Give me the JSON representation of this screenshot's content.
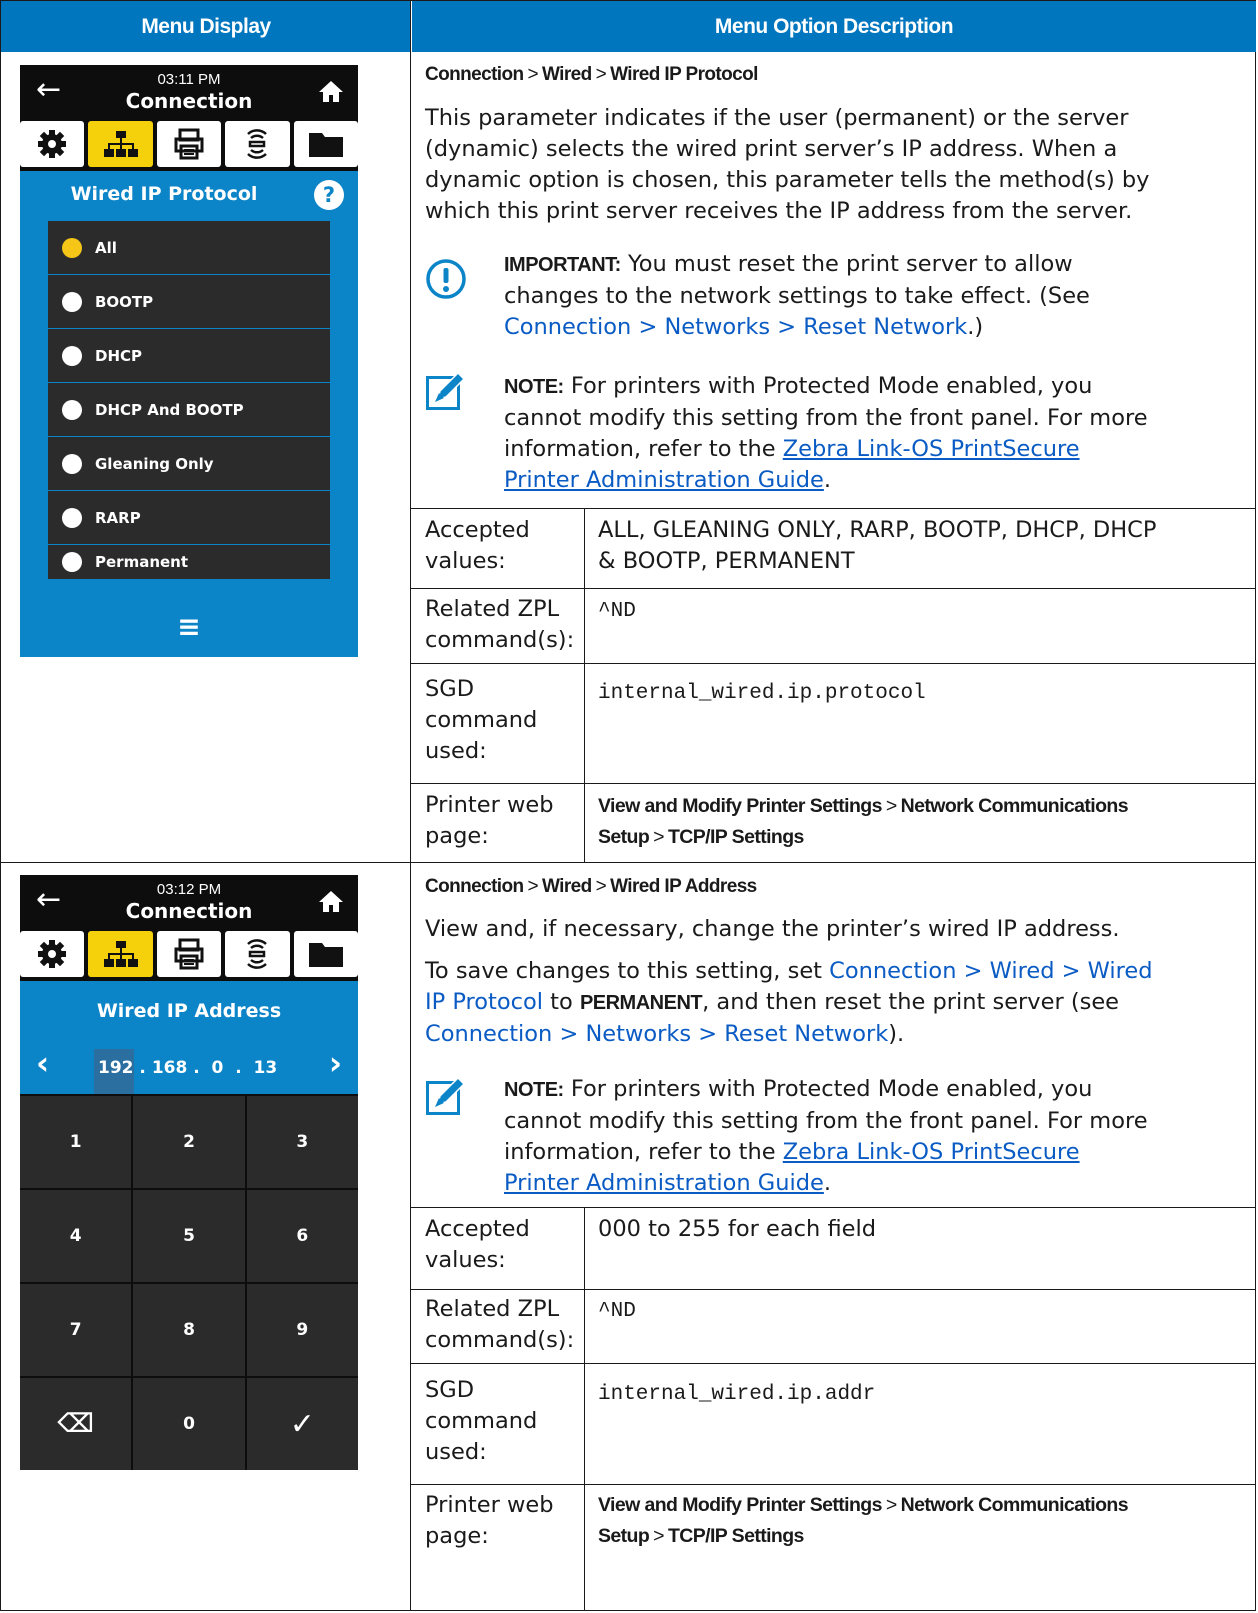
{
  "header": {
    "menu_display": "Menu Display",
    "menu_option_description": "Menu Option Description"
  },
  "row1": {
    "screen": {
      "time": "03:11 PM",
      "title": "Connection",
      "sub_title": "Wired IP Protocol",
      "help": "?",
      "options": [
        "All",
        "BOOTP",
        "DHCP",
        "DHCP And BOOTP",
        "Gleaning Only",
        "RARP",
        "Permanent"
      ],
      "selected_option": "All",
      "bottom_icon": "≡"
    },
    "path": {
      "p1": "Connection",
      "sep": ">",
      "p2": "Wired",
      "p3": "Wired IP Protocol"
    },
    "desc": [
      "This parameter indicates if the user (permanent) or the server",
      "(dynamic) selects the wired print server’s IP address. When a",
      "dynamic option is chosen, this parameter tells the method(s) by",
      "which this print server receives the IP address from the server."
    ],
    "important": {
      "label": "IMPORTANT:",
      "l1": " You must reset the print server to allow",
      "l2": "changes to the network settings to take effect. (See",
      "link": "Connection > Networks > Reset Network",
      "tail": ".)"
    },
    "note": {
      "label": "NOTE:",
      "l1": " For printers with Protected Mode enabled, you",
      "l2": "cannot modify this setting from the front panel. For more",
      "l3": "information, refer to the ",
      "link1": "Zebra Link-OS PrintSecure",
      "link2": "Printer Administration Guide",
      "tail": "."
    },
    "accepted_label": [
      "Accepted",
      "values:"
    ],
    "accepted_value": [
      "ALL, GLEANING ONLY, RARP, BOOTP, DHCP, DHCP",
      "& BOOTP, PERMANENT"
    ],
    "zpl_label": [
      "Related ZPL",
      "command(s):"
    ],
    "zpl_value": "^ND",
    "sgd_label": [
      "SGD",
      "command",
      "used:"
    ],
    "sgd_value": "internal_wired.ip.protocol",
    "web_label": [
      "Printer web",
      "page:"
    ],
    "web_value": {
      "a": "View and Modify Printer Settings",
      "sep": ">",
      "b": "Network Communications",
      "c": "Setup",
      "d": "TCP/IP Settings"
    }
  },
  "row2": {
    "screen": {
      "time": "03:12 PM",
      "title": "Connection",
      "sub_title": "Wired IP Address",
      "ip": [
        "192",
        ".",
        "168",
        ".",
        "0",
        ".",
        "13"
      ],
      "keys": [
        "1",
        "2",
        "3",
        "4",
        "5",
        "6",
        "7",
        "8",
        "9",
        "⌫",
        "0",
        "✓"
      ]
    },
    "path": {
      "p1": "Connection",
      "sep": ">",
      "p2": "Wired",
      "p3": "Wired IP Address"
    },
    "desc1": "View and, if necessary, change the printer’s wired IP address.",
    "desc2": {
      "pre": "To save changes to this setting, set ",
      "link1": "Connection > Wired > Wired",
      "link2": "IP Protocol",
      "mid": " to ",
      "bold": "PERMANENT",
      "post": ", and then reset the print server (see",
      "link3": "Connection > Networks > Reset Network",
      "tail": ")."
    },
    "note": {
      "label": "NOTE:",
      "l1": " For printers with Protected Mode enabled, you",
      "l2": "cannot modify this setting from the front panel. For more",
      "l3": "information, refer to the ",
      "link1": "Zebra Link-OS PrintSecure",
      "link2": "Printer Administration Guide",
      "tail": "."
    },
    "accepted_label": [
      "Accepted",
      "values:"
    ],
    "accepted_value": "000 to 255 for each field",
    "zpl_label": [
      "Related ZPL",
      "command(s):"
    ],
    "zpl_value": "^ND",
    "sgd_label": [
      "SGD",
      "command",
      "used:"
    ],
    "sgd_value": "internal_wired.ip.addr",
    "web_label": [
      "Printer web",
      "page:"
    ],
    "web_value": {
      "a": "View and Modify Printer Settings",
      "sep": ">",
      "b": "Network Communications",
      "c": "Setup",
      "d": "TCP/IP Settings"
    }
  },
  "colors": {
    "header_blue": "#0076bf",
    "link_blue": "#0a5bc4",
    "screen_blue": "#0b84c8",
    "accent_yellow": "#f5d10c"
  }
}
